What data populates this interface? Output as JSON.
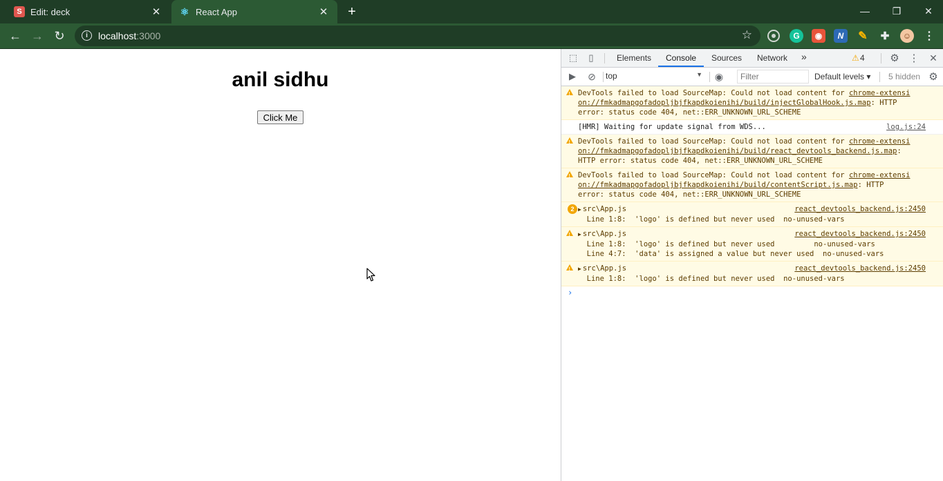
{
  "browser": {
    "tabs": [
      {
        "favicon": "S",
        "title": "Edit: deck",
        "active": false
      },
      {
        "favicon": "react-icon",
        "title": "React App",
        "active": true
      }
    ],
    "new_tab": "+",
    "address": {
      "host": "localhost",
      "port": ":3000"
    },
    "window_controls": {
      "minimize": "—",
      "restore": "❐",
      "close": "✕"
    },
    "theme_colors": {
      "frame": "#1f3d26",
      "toolbar": "#2c5a34"
    }
  },
  "page": {
    "heading": "anil sidhu",
    "button_label": "Click Me"
  },
  "devtools": {
    "tabs": [
      "Elements",
      "Console",
      "Sources",
      "Network"
    ],
    "active_tab": "Console",
    "more_tabs": "»",
    "warning_count": "4",
    "context": "top",
    "filter_placeholder": "Filter",
    "levels": "Default levels ▾",
    "hidden": "5 hidden",
    "messages": [
      {
        "type": "warning",
        "line1_text": "DevTools failed to load SourceMap: Could not load content for ",
        "line1_link": "chrome-extensi",
        "line2_link": "on://fmkadmapgofadopljbjfkapdkoienihi/build/injectGlobalHook.js.map",
        "line2_text": ": HTTP",
        "line3": "error: status code 404, net::ERR_UNKNOWN_URL_SCHEME"
      },
      {
        "type": "info",
        "text": "[HMR] Waiting for update signal from WDS...",
        "source": "log.js:24"
      },
      {
        "type": "warning",
        "line1_text": "DevTools failed to load SourceMap: Could not load content for ",
        "line1_link": "chrome-extensi",
        "line2_link": "on://fmkadmapgofadopljbjfkapdkoienihi/build/react_devtools_backend.js.map",
        "line2_text": ":",
        "line3": "HTTP error: status code 404, net::ERR_UNKNOWN_URL_SCHEME"
      },
      {
        "type": "warning",
        "line1_text": "DevTools failed to load SourceMap: Could not load content for ",
        "line1_link": "chrome-extensi",
        "line2_link": "on://fmkadmapgofadopljbjfkapdkoienihi/build/contentScript.js.map",
        "line2_text": ": HTTP",
        "line3": "error: status code 404, net::ERR_UNKNOWN_URL_SCHEME"
      },
      {
        "type": "warning-group",
        "badge": "2",
        "title": "src\\App.js",
        "source": "react_devtools_backend.js:2450",
        "lines": [
          "  Line 1:8:  'logo' is defined but never used  no-unused-vars"
        ]
      },
      {
        "type": "warning-group",
        "title": "src\\App.js",
        "source": "react_devtools_backend.js:2450",
        "lines": [
          "  Line 1:8:  'logo' is defined but never used         no-unused-vars",
          "  Line 4:7:  'data' is assigned a value but never used  no-unused-vars"
        ]
      },
      {
        "type": "warning-group",
        "title": "src\\App.js",
        "source": "react_devtools_backend.js:2450",
        "lines": [
          "  Line 1:8:  'logo' is defined but never used  no-unused-vars"
        ]
      }
    ],
    "prompt": "›"
  }
}
